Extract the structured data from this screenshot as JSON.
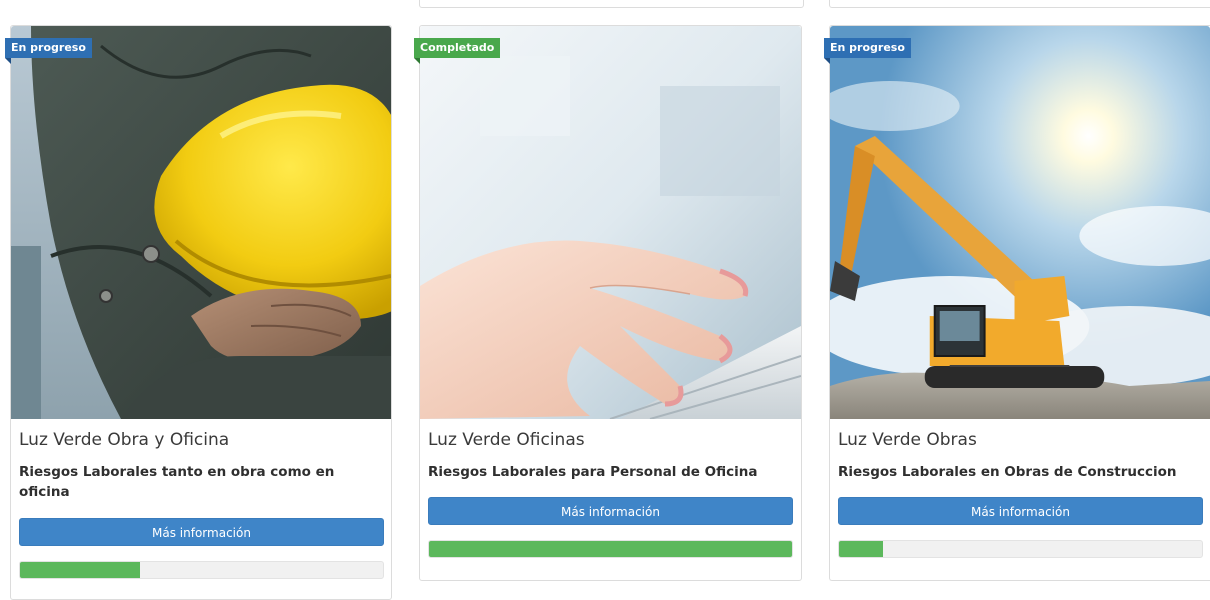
{
  "colors": {
    "badge_in_progress": "#2e6fb3",
    "badge_completed": "#49a84c",
    "button": "#3f85c8",
    "progress_fill": "#5cb85c",
    "progress_track": "#f1f1f1"
  },
  "courses": [
    {
      "status": "En progreso",
      "status_type": "in-progress",
      "image": "worker-holding-yellow-hard-hat",
      "title": "Luz Verde Obra y Oficina",
      "subtitle": "Riesgos Laborales tanto en obra como en oficina",
      "button_label": "Más información",
      "progress": 0.33
    },
    {
      "status": "Completado",
      "status_type": "completed",
      "image": "hand-typing-on-keyboard",
      "title": "Luz Verde Oficinas",
      "subtitle": "Riesgos Laborales para Personal de Oficina",
      "button_label": "Más información",
      "progress": 1.0
    },
    {
      "status": "En progreso",
      "status_type": "in-progress",
      "image": "excavator-under-sunny-sky",
      "title": "Luz Verde Obras",
      "subtitle": "Riesgos Laborales en Obras de Construccion",
      "button_label": "Más información",
      "progress": 0.12
    }
  ]
}
